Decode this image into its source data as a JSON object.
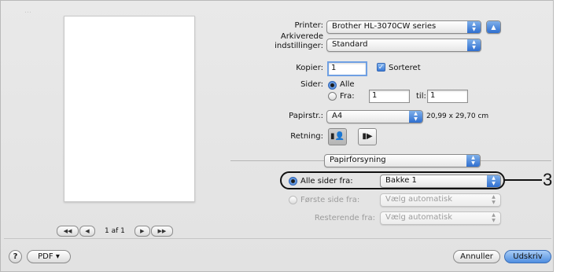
{
  "background_title_ghost": "…",
  "preview": {
    "page_info": "1 af 1",
    "first_icon": "first-page-icon",
    "prev_icon": "previous-page-icon",
    "next_icon": "next-page-icon",
    "last_icon": "last-page-icon"
  },
  "printer": {
    "label": "Printer:",
    "value": "Brother HL-3070CW series",
    "expand_icon": "disclosure-up-icon"
  },
  "presets": {
    "label_line1": "Arkiverede",
    "label_line2": "indstillinger:",
    "value": "Standard"
  },
  "copies": {
    "label": "Kopier:",
    "value": "1",
    "collate_label": "Sorteret",
    "collate_checked": true
  },
  "pages": {
    "label": "Sider:",
    "all_label": "Alle",
    "from_label": "Fra:",
    "from_value": "1",
    "to_label": "til:",
    "to_value": "1",
    "selected": "all"
  },
  "paper_size": {
    "label": "Papirstr.:",
    "value": "A4",
    "dimensions": "20,99 x 29,70 cm"
  },
  "orientation": {
    "label": "Retning:",
    "portrait_icon": "portrait-orientation-icon",
    "landscape_icon": "landscape-orientation-icon",
    "selected": "portrait"
  },
  "section": {
    "value": "Papirforsyning"
  },
  "paper_feed": {
    "all_pages_label": "Alle sider fra:",
    "all_pages_value": "Bakke 1",
    "first_page_label": "Første side fra:",
    "first_page_value": "Vælg automatisk",
    "remaining_label": "Resterende fra:",
    "remaining_value": "Vælg automatisk",
    "selected": "all_pages"
  },
  "footer": {
    "help": "?",
    "pdf_label": "PDF ▾",
    "cancel_label": "Annuller",
    "print_label": "Udskriv"
  },
  "callout": {
    "number": "3"
  },
  "colors": {
    "accent": "#3a7ad6",
    "dialog_bg": "#e6e6e6"
  }
}
